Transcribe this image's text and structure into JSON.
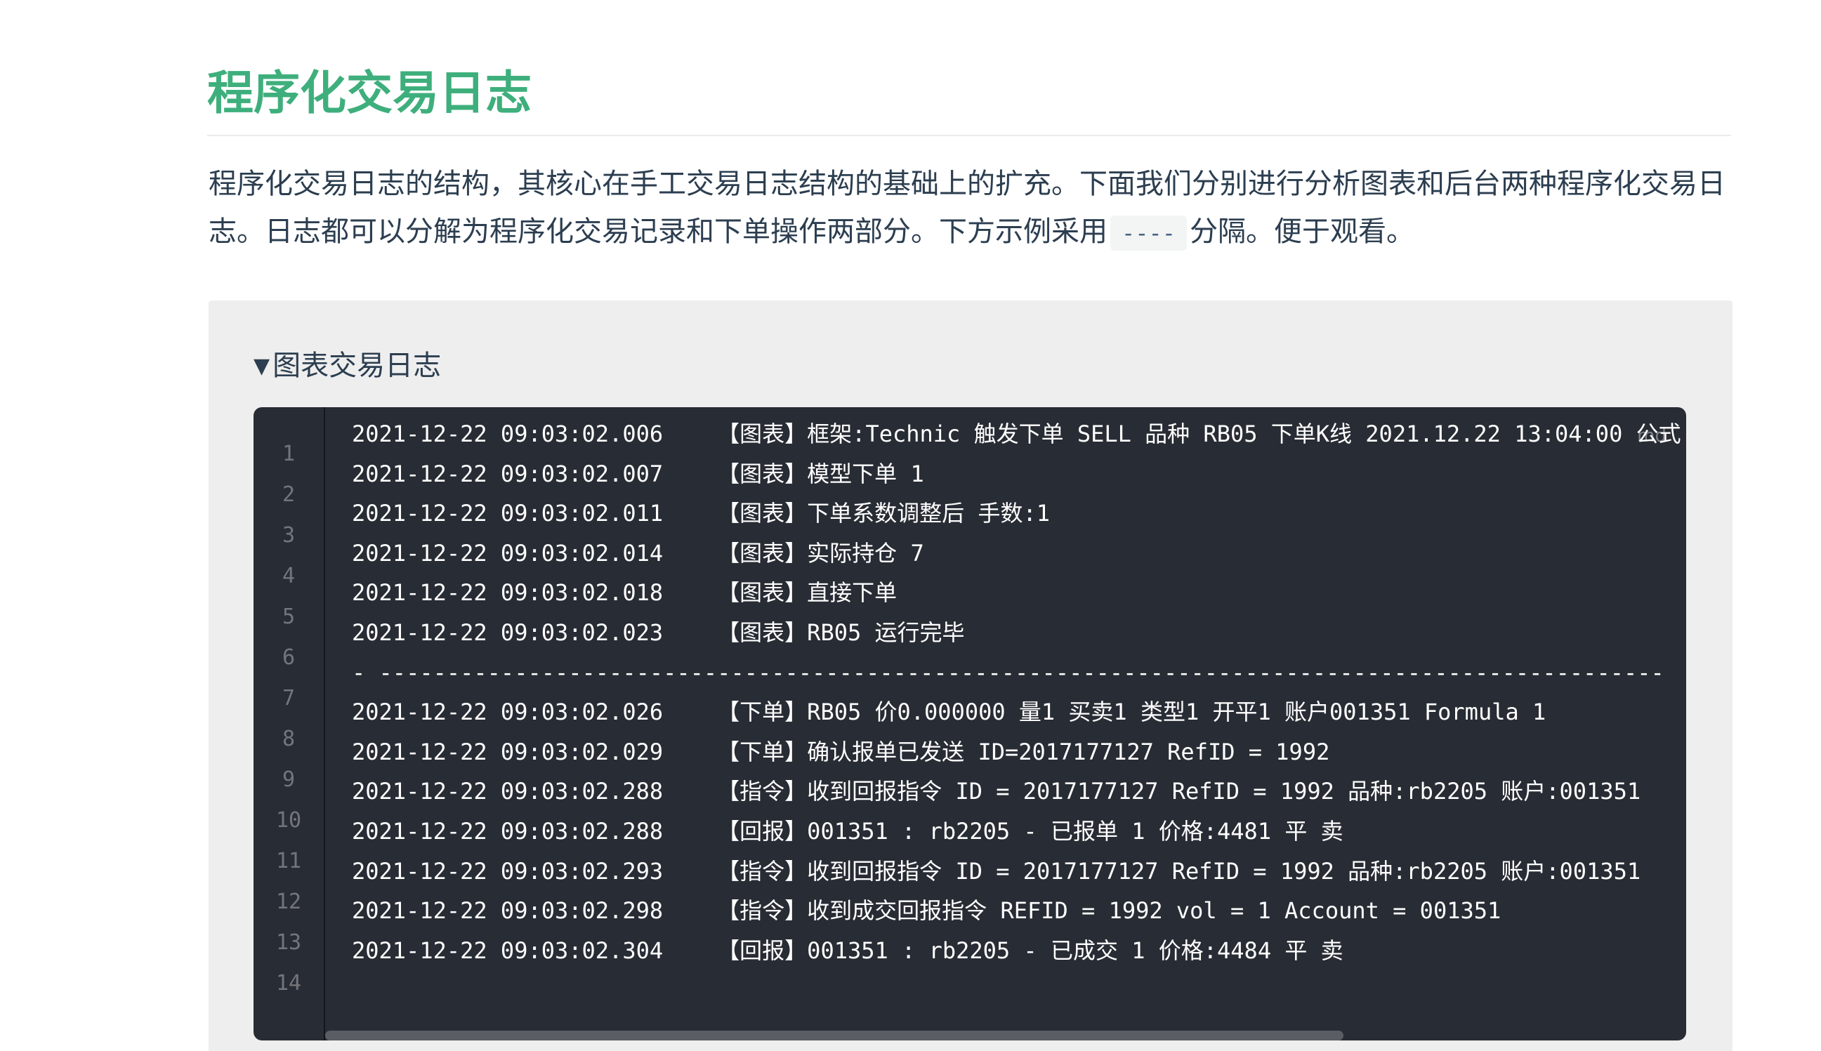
{
  "page": {
    "title": "程序化交易日志",
    "intro_before_code": "程序化交易日志的结构，其核心在手工交易日志结构的基础上的扩充。下面我们分别进行分析图表和后台两种程序化交易日志。日志都可以分解为程序化交易记录和下单操作两部分。下方示例采用",
    "intro_code": "----",
    "intro_after_code": "分隔。便于观看。"
  },
  "details": {
    "summary": "图表交易日志",
    "triangle_icon": "triangle-down-icon"
  },
  "code": {
    "language": "md",
    "line_numbers": [
      "1",
      "2",
      "3",
      "4",
      "5",
      "6",
      "7",
      "8",
      "9",
      "10",
      "11",
      "12",
      "13",
      "14"
    ],
    "lines": [
      "2021-12-22 09:03:02.006    【图表】框架:Technic 触发下单 SELL 品种 RB05 下单K线 2021.12.22 13:04:00 公式",
      "2021-12-22 09:03:02.007    【图表】模型下单 1",
      "2021-12-22 09:03:02.011    【图表】下单系数调整后 手数:1",
      "2021-12-22 09:03:02.014    【图表】实际持仓 7",
      "2021-12-22 09:03:02.018    【图表】直接下单",
      "2021-12-22 09:03:02.023    【图表】RB05 运行完毕",
      "- -----------------------------------------------------------------------------------------------",
      "2021-12-22 09:03:02.026    【下单】RB05 价0.000000 量1 买卖1 类型1 开平1 账户001351 Formula 1",
      "2021-12-22 09:03:02.029    【下单】确认报单已发送 ID=2017177127 RefID = 1992",
      "2021-12-22 09:03:02.288    【指令】收到回报指令 ID = 2017177127 RefID = 1992 品种:rb2205 账户:001351",
      "2021-12-22 09:03:02.288    【回报】001351 : rb2205 - 已报单 1 价格:4481 平 卖",
      "2021-12-22 09:03:02.293    【指令】收到回报指令 ID = 2017177127 RefID = 1992 品种:rb2205 账户:001351",
      "2021-12-22 09:03:02.298    【指令】收到成交回报指令 REFID = 1992 vol = 1 Account = 001351",
      "2021-12-22 09:03:02.304    【回报】001351 : rb2205 - 已成交 1 价格:4484 平 卖"
    ]
  },
  "colors": {
    "title": "#3eaf7c",
    "text": "#2c3e50",
    "code_background": "#282c34",
    "details_background": "#eeeeee"
  }
}
